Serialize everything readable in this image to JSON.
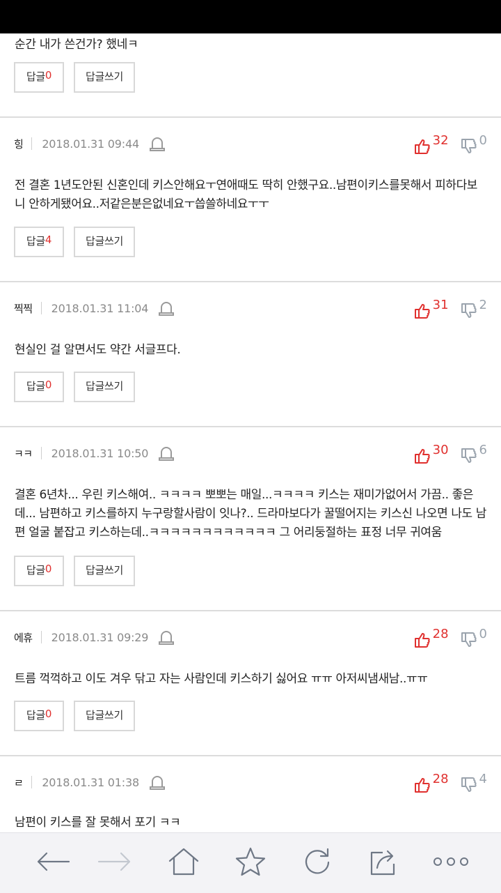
{
  "partial_comment": {
    "text": "순간 내가 쓴건가? 했네ㅋ",
    "reply_label": "답글",
    "reply_count": "0",
    "write_label": "답글쓰기"
  },
  "comments": [
    {
      "nick": "힝",
      "date": "2018.01.31 09:44",
      "up": "32",
      "down": "0",
      "text": "전 결혼 1년도안된 신혼인데 키스안해요ㅜ연애때도 딱히 안했구요..남편이키스를못해서 피하다보니 안하게됐어요..저같은분은없네요ㅜ씁쓸하네요ㅜㅜ",
      "reply_label": "답글",
      "reply_count": "4",
      "write_label": "답글쓰기"
    },
    {
      "nick": "찍찍",
      "date": "2018.01.31 11:04",
      "up": "31",
      "down": "2",
      "text": "현실인 걸 알면서도 약간 서글프다.",
      "reply_label": "답글",
      "reply_count": "0",
      "write_label": "답글쓰기"
    },
    {
      "nick": "ㅋㅋ",
      "date": "2018.01.31 10:50",
      "up": "30",
      "down": "6",
      "text": "결혼 6년차... 우린 키스해여.. ㅋㅋㅋㅋ 뽀뽀는 매일...ㅋㅋㅋㅋ 키스는 재미가없어서 가끔.. 좋은데... 남편하고 키스를하지 누구랑할사람이 잇나?.. 드라마보다가 꿀떨어지는 키스신 나오면 나도 남편 얼굴 붙잡고 키스하는데..ㅋㅋㅋㅋㅋㅋㅋㅋㅋㅋㅋㅋ 그 어리둥절하는 표정 너무 귀여움",
      "reply_label": "답글",
      "reply_count": "0",
      "write_label": "답글쓰기"
    },
    {
      "nick": "에휴",
      "date": "2018.01.31 09:29",
      "up": "28",
      "down": "0",
      "text": "트름 꺽꺽하고 이도 겨우 닦고 자는 사람인데 키스하기 싫어요 ㅠㅠ 아저씨냄새남..ㅠㅠ",
      "reply_label": "답글",
      "reply_count": "0",
      "write_label": "답글쓰기"
    },
    {
      "nick": "ㄹ",
      "date": "2018.01.31 01:38",
      "up": "28",
      "down": "4",
      "text": "남편이 키스를 잘 못해서 포기 ㅋㅋ"
    }
  ],
  "icons": {
    "report": "siren-icon",
    "like": "thumbs-up-icon",
    "dislike": "thumbs-down-icon",
    "back": "back-arrow-icon",
    "forward": "forward-arrow-icon",
    "home": "home-icon",
    "bookmark": "star-icon",
    "refresh": "refresh-icon",
    "share": "share-icon",
    "more": "more-icon"
  },
  "colors": {
    "like": "#e0302e",
    "dislike": "#9aa3ad",
    "divider": "#dcdcdc",
    "toolbar_bg": "#f3f3f6"
  }
}
